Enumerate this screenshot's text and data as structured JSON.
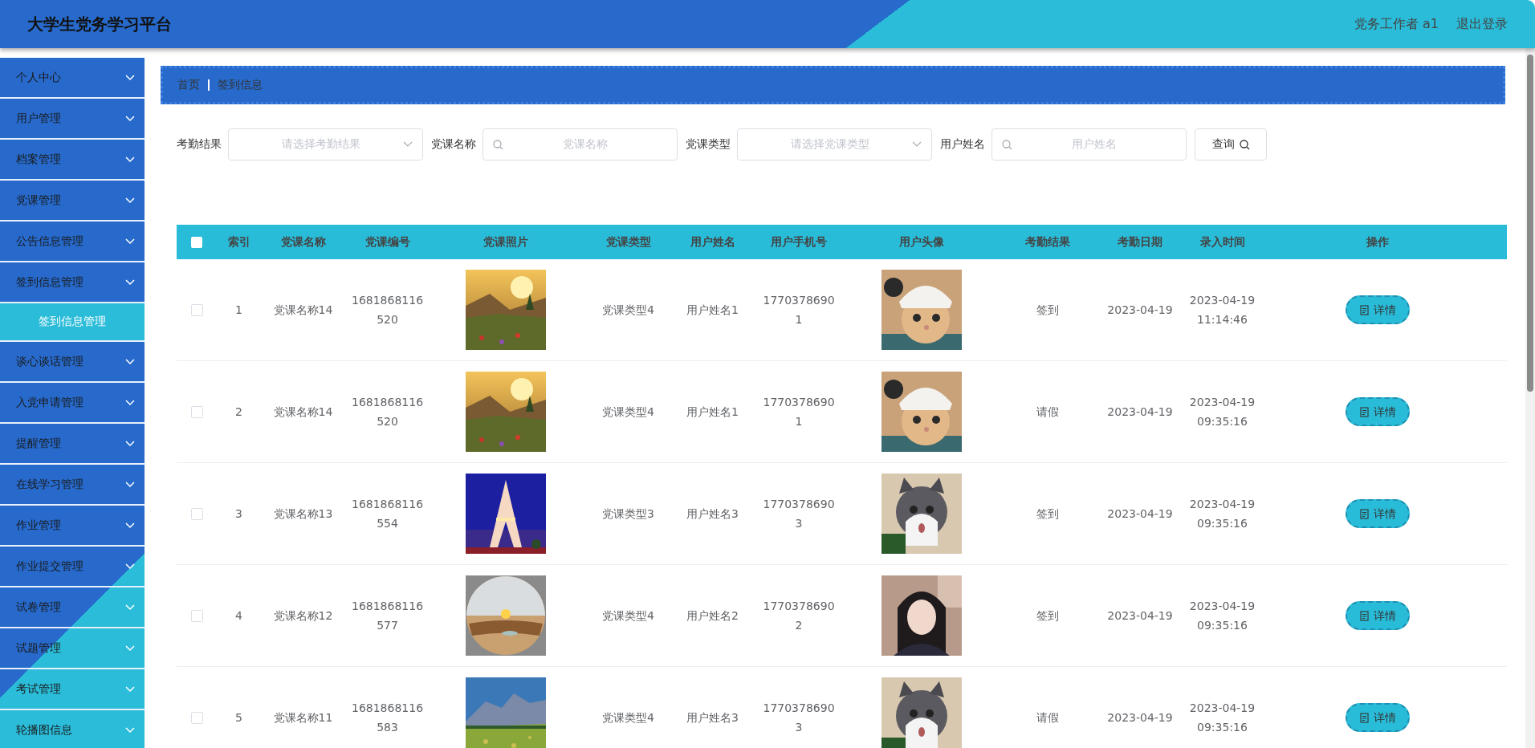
{
  "header": {
    "title": "大学生党务学习平台",
    "user": "党务工作者 a1",
    "logout": "退出登录"
  },
  "sidebar": {
    "items": [
      {
        "label": "个人中心"
      },
      {
        "label": "用户管理"
      },
      {
        "label": "档案管理"
      },
      {
        "label": "党课管理"
      },
      {
        "label": "公告信息管理"
      },
      {
        "label": "签到信息管理",
        "children": [
          {
            "label": "签到信息管理",
            "selected": true
          }
        ]
      },
      {
        "label": "谈心谈话管理"
      },
      {
        "label": "入党申请管理"
      },
      {
        "label": "提醒管理"
      },
      {
        "label": "在线学习管理"
      },
      {
        "label": "作业管理"
      },
      {
        "label": "作业提交管理"
      },
      {
        "label": "试卷管理"
      },
      {
        "label": "试题管理"
      },
      {
        "label": "考试管理"
      },
      {
        "label": "轮播图信息"
      }
    ]
  },
  "breadcrumb": [
    "首页",
    "签到信息"
  ],
  "filters": [
    {
      "kind": "select",
      "label": "考勤结果",
      "placeholder": "请选择考勤结果"
    },
    {
      "kind": "search",
      "label": "党课名称",
      "placeholder": "党课名称"
    },
    {
      "kind": "select",
      "label": "党课类型",
      "placeholder": "请选择党课类型"
    },
    {
      "kind": "search",
      "label": "用户姓名",
      "placeholder": "用户姓名"
    }
  ],
  "query_button": "查询",
  "table": {
    "all_checked": false,
    "columns": [
      "索引",
      "党课名称",
      "党课编号",
      "党课照片",
      "党课类型",
      "用户姓名",
      "用户手机号",
      "用户头像",
      "考勤结果",
      "考勤日期",
      "录入时间",
      "操作"
    ],
    "rows": [
      {
        "checked": false,
        "index": "1",
        "course_name": "党课名称14",
        "course_no": "1681868116520",
        "course_type": "党课类型4",
        "user_name": "用户姓名1",
        "phone": "17703786901",
        "result": "签到",
        "date": "2023-04-19",
        "entered": "2023-04-19 11:14:46",
        "action": "详情"
      },
      {
        "checked": false,
        "index": "2",
        "course_name": "党课名称14",
        "course_no": "1681868116520",
        "course_type": "党课类型4",
        "user_name": "用户姓名1",
        "phone": "17703786901",
        "result": "请假",
        "date": "2023-04-19",
        "entered": "2023-04-19 09:35:16",
        "action": "详情"
      },
      {
        "checked": false,
        "index": "3",
        "course_name": "党课名称13",
        "course_no": "1681868116554",
        "course_type": "党课类型3",
        "user_name": "用户姓名3",
        "phone": "17703786903",
        "result": "签到",
        "date": "2023-04-19",
        "entered": "2023-04-19 09:35:16",
        "action": "详情"
      },
      {
        "checked": false,
        "index": "4",
        "course_name": "党课名称12",
        "course_no": "1681868116577",
        "course_type": "党课类型4",
        "user_name": "用户姓名2",
        "phone": "17703786902",
        "result": "签到",
        "date": "2023-04-19",
        "entered": "2023-04-19 09:35:16",
        "action": "详情"
      },
      {
        "checked": false,
        "index": "5",
        "course_name": "党课名称11",
        "course_no": "1681868116583",
        "course_type": "党课类型4",
        "user_name": "用户姓名3",
        "phone": "17703786903",
        "result": "请假",
        "date": "2023-04-19",
        "entered": "2023-04-19 09:35:16",
        "action": "详情"
      }
    ]
  }
}
